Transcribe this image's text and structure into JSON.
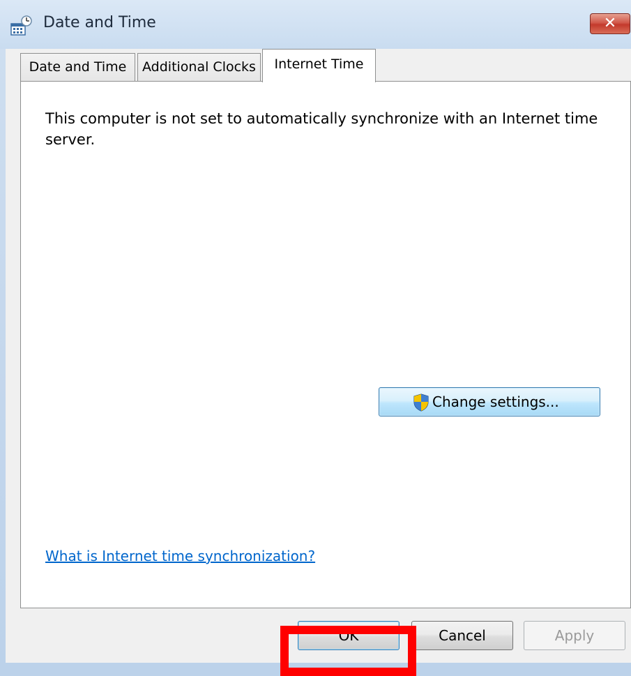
{
  "window": {
    "title": "Date and Time",
    "close_glyph": "✕"
  },
  "tabs": [
    {
      "label": "Date and Time",
      "active": false
    },
    {
      "label": "Additional Clocks",
      "active": false
    },
    {
      "label": "Internet Time",
      "active": true
    }
  ],
  "panel": {
    "message": "This computer is not set to automatically synchronize with an Internet time server.",
    "change_settings_label": "Change settings...",
    "help_link": "What is Internet time synchronization?"
  },
  "buttons": {
    "ok": "OK",
    "cancel": "Cancel",
    "apply": "Apply"
  },
  "icons": {
    "app": "calendar-clock-icon",
    "shield": "uac-shield-icon",
    "close": "close-icon"
  },
  "colors": {
    "link": "#0066cc",
    "annotation": "#ff0000",
    "close_button": "#c3392c"
  }
}
